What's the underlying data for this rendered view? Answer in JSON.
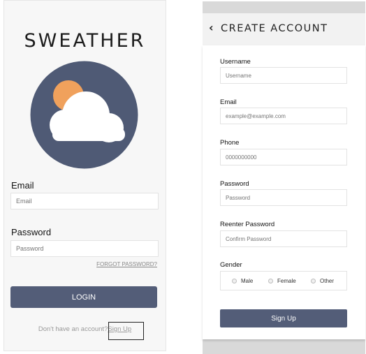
{
  "colors": {
    "accent": "#535d78",
    "logo_circle": "#4f5a75",
    "sun": "#f0a15c",
    "cloud": "#ffffff"
  },
  "login": {
    "brand": "SWEATHER",
    "logo_icon": "sun-cloud-icon",
    "email_label": "Email",
    "email_placeholder": "Email",
    "password_label": "Password",
    "password_placeholder": "Password",
    "forgot_password": "FORGOT PASSWORD?",
    "login_button": "LOGIN",
    "no_account_text": "Don't have an account?",
    "signup_link": "Sign Up"
  },
  "create_account": {
    "back_icon": "chevron-left-icon",
    "title": "CREATE ACCOUNT",
    "fields": [
      {
        "label": "Username",
        "placeholder": "Username"
      },
      {
        "label": "Email",
        "placeholder": "example@example.com"
      },
      {
        "label": "Phone",
        "placeholder": "0000000000"
      },
      {
        "label": "Password",
        "placeholder": "Password"
      },
      {
        "label": "Reenter Password",
        "placeholder": "Confirm Password"
      }
    ],
    "gender_label": "Gender",
    "gender_options": [
      "Male",
      "Female",
      "Other"
    ],
    "signup_button": "Sign Up"
  }
}
